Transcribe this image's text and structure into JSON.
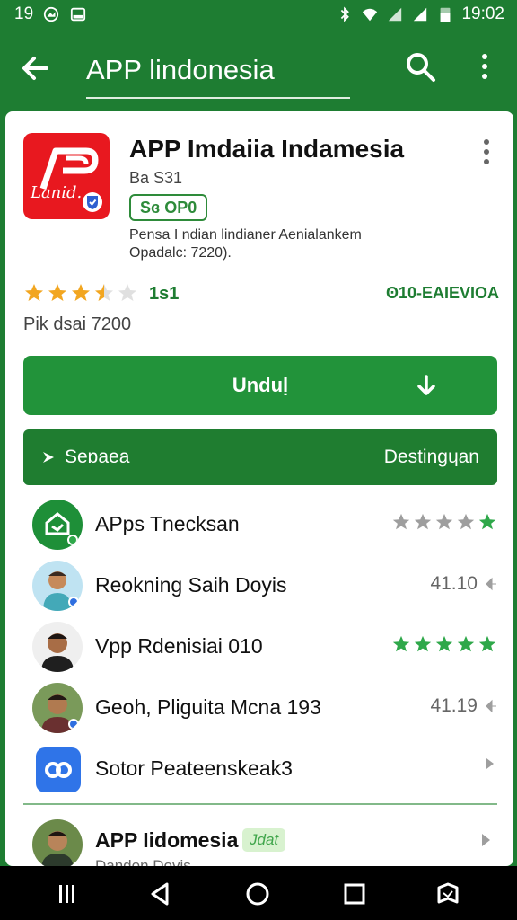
{
  "status": {
    "time_left": "19",
    "time_right": "19:02"
  },
  "toolbar": {
    "title": "APP lindonesia"
  },
  "app": {
    "title": "APP Imdaiia Indamesia",
    "sub": "Ba S31",
    "tag": "Sɞ OP0",
    "desc_line1": "Pensa I ndian lindianer Aenialankem",
    "desc_line2": "Opadalc: 7220).",
    "icon_text": "Lanid.",
    "rating": "1s1",
    "stars": 3.5,
    "badge": "ʘ10-EAIEVIOA",
    "downloads": "Pik dsai 7200"
  },
  "actions": {
    "install_label": "Unduḷ",
    "bar_left": "Seɒaea",
    "bar_right": "Destingɥan"
  },
  "list": [
    {
      "name": "APps Tnecksan",
      "right_text": "",
      "stars": 5,
      "star_color": "#9e9e9e"
    },
    {
      "name": "Reokning Saih Doyis",
      "right_text": "41.10",
      "stars": 0
    },
    {
      "name": "Vpp Rdenisiai 010",
      "right_text": "",
      "stars": 5,
      "star_color": "#2fa84a"
    },
    {
      "name": "Geoh, Pliguita Mcna 193",
      "right_text": "41.19",
      "stars": 0
    },
    {
      "name": "Sotor Peateenskeak3",
      "right_text": "",
      "stars": 0
    }
  ],
  "bottom": {
    "name": "APP Iidomesia",
    "pill": "Jdat",
    "sub": "Dandon Dovis"
  },
  "colors": {
    "primary": "#1e7d32",
    "button": "#22933a",
    "star_gold": "#f2a620",
    "star_green": "#2fa84a"
  }
}
